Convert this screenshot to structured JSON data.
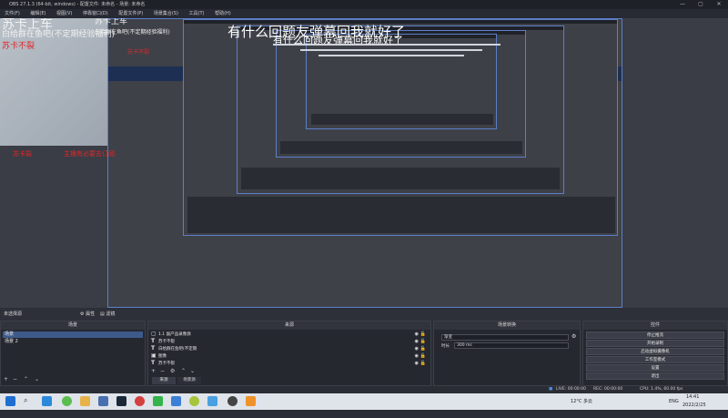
{
  "window": {
    "title": "OBS 27.1.3 (64-bit, windows) - 配置文件: 未命名 - 场景: 未命名",
    "controls": [
      "—",
      "▢",
      "✕"
    ]
  },
  "menu": [
    "文件(F)",
    "编辑(E)",
    "视图(V)",
    "停靠窗口(D)",
    "配置文件(P)",
    "场景集合(S)",
    "工具(T)",
    "帮助(H)"
  ],
  "overlay": {
    "title_big": "苏卡上车",
    "line_white": "白给群在鱼吧(不定期经验福利)",
    "line_red": "苏卡不裂",
    "banner_text": "有什么回题友弹幕回我就好了",
    "streamer": "苏卡裂",
    "subscribe": "主播有必要去订阅"
  },
  "preview_bar": {
    "label": "未选择源",
    "props": "属性",
    "filters": "滤镜"
  },
  "docks": {
    "scenes": {
      "title": "场景",
      "items": [
        "场景",
        "场景 2"
      ],
      "tools": [
        "+",
        "−",
        "⌃",
        "⌄"
      ]
    },
    "sources": {
      "title": "来源",
      "items": [
        {
          "icon": "▢",
          "label": "1.1 副产品录像源"
        },
        {
          "icon": "T",
          "label": "苏卡不裂"
        },
        {
          "icon": "T",
          "label": "白给群在鱼吧(不定期"
        },
        {
          "icon": "▣",
          "label": "图像"
        },
        {
          "icon": "T",
          "label": "苏卡不裂"
        }
      ],
      "tools": [
        "+",
        "−",
        "⚙",
        "⌃",
        "⌄"
      ],
      "tabs": [
        "来源",
        "场景源"
      ]
    },
    "audio": {
      "title": "场景转换",
      "transition": "渐变",
      "duration_label": "时长",
      "duration_value": "300 ms"
    },
    "controls": {
      "title": "控件",
      "buttons": [
        "停止推流",
        "开始录制",
        "启动虚拟摄像机",
        "工作室模式",
        "设置",
        "退出"
      ]
    }
  },
  "status": {
    "live": "LIVE: 00:00:00",
    "rec": "REC: 00:00:00",
    "cpu": "CPU: 1.4%, 60.00 fps"
  },
  "taskbar": {
    "weather": "12°C 多云",
    "lang": "ENG",
    "time": "14:41",
    "date": "2022/2/25"
  },
  "colors": {
    "accent": "#5b7fc7",
    "red": "#e0262a",
    "dark": "#262830",
    "taskbar": "#dfe3ea"
  }
}
